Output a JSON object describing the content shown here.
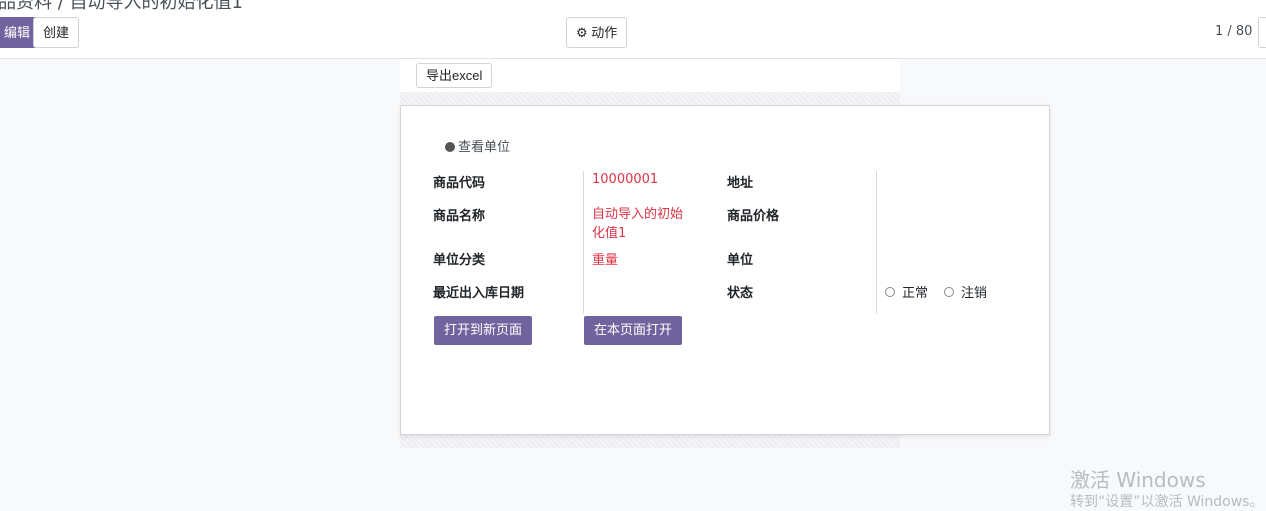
{
  "control_panel": {
    "breadcrumb_partial": "品资料 / 自动导入的初始化值1",
    "edit_label": "编辑",
    "create_label": "创建",
    "action_label": "动作",
    "pager_text": "1 / 80"
  },
  "toolbar": {
    "export_label": "导出excel"
  },
  "form": {
    "smart_button_label": "查看单位",
    "fields": {
      "product_code": {
        "label": "商品代码",
        "value": "10000001"
      },
      "product_name": {
        "label": "商品名称",
        "value": "自动导入的初始化值1"
      },
      "unit_category": {
        "label": "单位分类",
        "value": "重量"
      },
      "last_stock_date": {
        "label": "最近出入库日期",
        "value": ""
      },
      "address": {
        "label": "地址",
        "value": ""
      },
      "product_price": {
        "label": "商品价格",
        "value": ""
      },
      "unit": {
        "label": "单位",
        "value": ""
      },
      "status": {
        "label": "状态",
        "options": [
          "正常",
          "注销"
        ]
      }
    },
    "open_new_page_label": "打开到新页面",
    "open_this_page_label": "在本页面打开"
  },
  "watermark": {
    "line1": "激活 Windows",
    "line2": "转到“设置”以激活 Windows。"
  },
  "colors": {
    "accent": "#71639e",
    "value_red": "#dc3545"
  }
}
